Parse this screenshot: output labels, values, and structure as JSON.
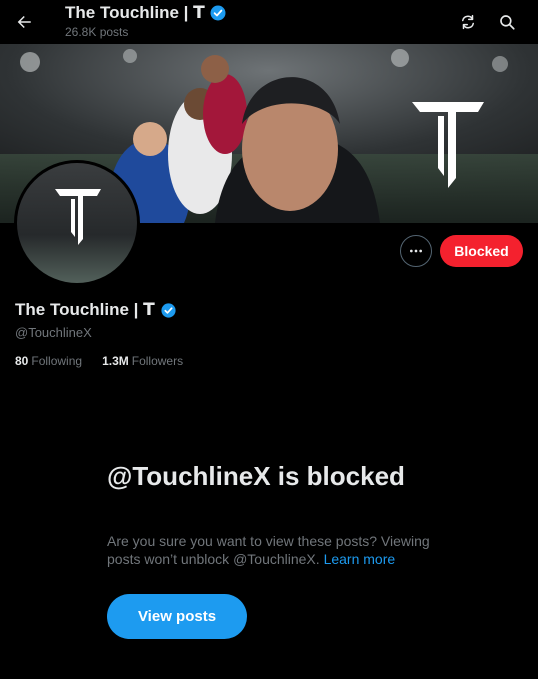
{
  "header": {
    "title": "The Touchline | 𝗧",
    "post_count": "26.8K posts",
    "back_icon": "arrow-left-icon",
    "refresh_icon": "refresh-icon",
    "search_icon": "search-icon"
  },
  "profile": {
    "name": "The Touchline | 𝗧",
    "handle": "@TouchlineX",
    "verified": true,
    "banner_logo_letter": "T",
    "following_count": "80",
    "following_label": "Following",
    "followers_count": "1.3M",
    "followers_label": "Followers"
  },
  "actions": {
    "more_icon": "more-horizontal-icon",
    "blocked_label": "Blocked"
  },
  "blocked_notice": {
    "title": "@TouchlineX is blocked",
    "description": "Are you sure you want to view these posts? Viewing posts won’t unblock @TouchlineX.",
    "learn_more": "Learn more",
    "view_posts_label": "View posts"
  },
  "colors": {
    "background": "#000000",
    "text_primary": "#e7e9ea",
    "text_secondary": "#71767b",
    "accent_blue": "#1d9bf0",
    "blocked_red": "#f4212e"
  }
}
